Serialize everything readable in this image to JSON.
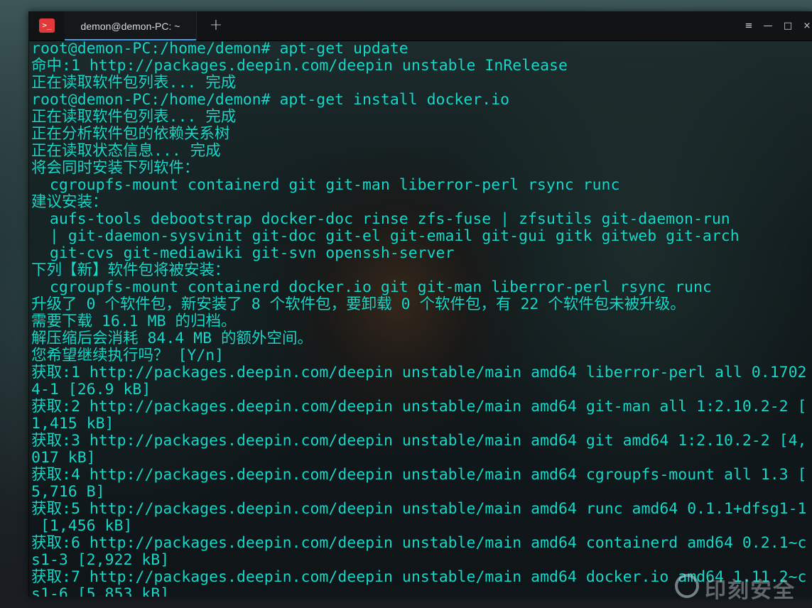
{
  "window": {
    "tab_title": "demon@demon-PC: ~",
    "app_icon_glyph": ">_",
    "new_tab_glyph": "+",
    "menu_glyph": "≡",
    "minimize_glyph": "—",
    "maximize_glyph": "□",
    "close_glyph": "×"
  },
  "colors": {
    "terminal_text": "#18d7c8",
    "tab_accent": "#2ca7f8",
    "app_icon": "#e23a3a"
  },
  "terminal": {
    "lines": [
      "root@demon-PC:/home/demon# apt-get update",
      "命中:1 http://packages.deepin.com/deepin unstable InRelease",
      "正在读取软件包列表... 完成",
      "root@demon-PC:/home/demon# apt-get install docker.io",
      "正在读取软件包列表... 完成",
      "正在分析软件包的依赖关系树",
      "正在读取状态信息... 完成",
      "将会同时安装下列软件：",
      "  cgroupfs-mount containerd git git-man liberror-perl rsync runc",
      "建议安装：",
      "  aufs-tools debootstrap docker-doc rinse zfs-fuse | zfsutils git-daemon-run",
      "  | git-daemon-sysvinit git-doc git-el git-email git-gui gitk gitweb git-arch",
      "  git-cvs git-mediawiki git-svn openssh-server",
      "下列【新】软件包将被安装：",
      "  cgroupfs-mount containerd docker.io git git-man liberror-perl rsync runc",
      "升级了 0 个软件包，新安装了 8 个软件包，要卸载 0 个软件包，有 22 个软件包未被升级。",
      "需要下载 16.1 MB 的归档。",
      "解压缩后会消耗 84.4 MB 的额外空间。",
      "您希望继续执行吗？ [Y/n]",
      "获取:1 http://packages.deepin.com/deepin unstable/main amd64 liberror-perl all 0.1702",
      "4-1 [26.9 kB]",
      "获取:2 http://packages.deepin.com/deepin unstable/main amd64 git-man all 1:2.10.2-2 [",
      "1,415 kB]",
      "获取:3 http://packages.deepin.com/deepin unstable/main amd64 git amd64 1:2.10.2-2 [4,",
      "017 kB]",
      "获取:4 http://packages.deepin.com/deepin unstable/main amd64 cgroupfs-mount all 1.3 [",
      "5,716 B]",
      "获取:5 http://packages.deepin.com/deepin unstable/main amd64 runc amd64 0.1.1+dfsg1-1",
      " [1,456 kB]",
      "获取:6 http://packages.deepin.com/deepin unstable/main amd64 containerd amd64 0.2.1~c",
      "s1-3 [2,922 kB]",
      "获取:7 http://packages.deepin.com/deepin unstable/main amd64 docker.io amd64 1.11.2~c",
      "s1-6 [5,853 kB]"
    ]
  },
  "watermark": {
    "text": "印刻安全"
  }
}
